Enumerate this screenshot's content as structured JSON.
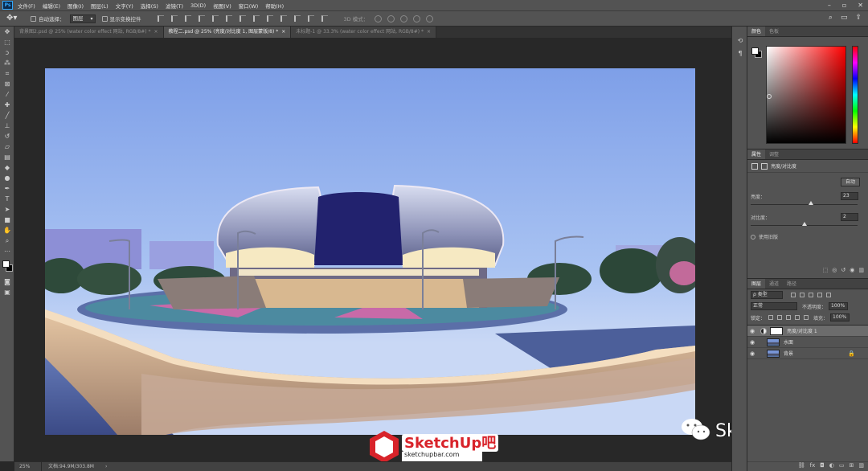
{
  "app": {
    "logo": "Ps",
    "window_controls": [
      "search-icon",
      "workspace-icon",
      "minimize-icon",
      "maximize-icon",
      "close-icon"
    ]
  },
  "menu": [
    "文件(F)",
    "编辑(E)",
    "图像(I)",
    "图层(L)",
    "文字(Y)",
    "选择(S)",
    "滤镜(T)",
    "3D(D)",
    "视图(V)",
    "窗口(W)",
    "帮助(H)"
  ],
  "options": {
    "auto_select_label": "自动选择：",
    "auto_select_value": "图层",
    "show_transform_label": "显示变换控件",
    "mode_3d_label": "3D 模式："
  },
  "tabs": [
    {
      "label": "背景图2.psd @ 25% (water color effect 网站, RGB/8#) *",
      "close": "×",
      "active": false
    },
    {
      "label": "教程二.psd @ 25% (亮度/对比度 1, 图层蒙版/8) *",
      "close": "×",
      "active": true
    },
    {
      "label": "未标题-1 @ 33.3% (water color effect 网站, RGB/8#) *",
      "close": "×",
      "active": false
    }
  ],
  "status": {
    "zoom": "25%",
    "doc_info": "文档:94.9M/303.8M",
    "arrow": "›"
  },
  "color_panel": {
    "tabs": [
      "颜色",
      "色板"
    ],
    "fg_color": "#ffffff",
    "bg_color": "#000000"
  },
  "properties_panel": {
    "tabs": [
      "属性",
      "调整"
    ],
    "title": "亮度/对比度",
    "auto_label": "自动",
    "brightness_label": "亮度：",
    "brightness_value": "23",
    "contrast_label": "对比度：",
    "contrast_value": "2",
    "legacy_label": "使用旧版"
  },
  "layers_panel": {
    "tabs": [
      "图层",
      "通道",
      "路径"
    ],
    "filter_label": "ρ 类型",
    "blend_mode": "正常",
    "opacity_label": "不透明度：",
    "opacity_value": "100%",
    "lock_label": "锁定：",
    "fill_label": "填充：",
    "fill_value": "100%",
    "layers": [
      {
        "name": "亮度/对比度 1",
        "type": "adjustment",
        "selected": true
      },
      {
        "name": "水面",
        "type": "image",
        "selected": false
      },
      {
        "name": "背景",
        "type": "image",
        "locked": true,
        "selected": false
      }
    ]
  },
  "watermarks": {
    "logo_text": "SketchUp吧",
    "logo_url": "sketchupbar.com",
    "wechat_text": "SketchUp吧"
  }
}
